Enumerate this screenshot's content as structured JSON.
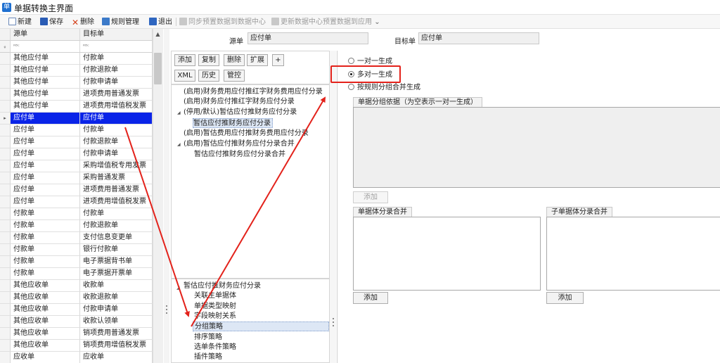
{
  "window": {
    "title": "单据转换主界面"
  },
  "toolbar": {
    "new": "新建",
    "save": "保存",
    "delete": "删除",
    "rule_manage": "规则管理",
    "exit": "退出",
    "sync_preset": "同步预置数据到数据中心",
    "update_center": "更新数据中心预置数据到应用"
  },
  "grid": {
    "col_source": "源单",
    "col_target": "目标单",
    "filter_icon": "filter-abc-icon",
    "rows": [
      {
        "s": "其他应付单",
        "t": "付款单"
      },
      {
        "s": "其他应付单",
        "t": "付款退款单"
      },
      {
        "s": "其他应付单",
        "t": "付款申请单"
      },
      {
        "s": "其他应付单",
        "t": "进项费用普通发票"
      },
      {
        "s": "其他应付单",
        "t": "进项费用增值税发票"
      },
      {
        "s": "应付单",
        "t": "应付单"
      },
      {
        "s": "应付单",
        "t": "付款单"
      },
      {
        "s": "应付单",
        "t": "付款退款单"
      },
      {
        "s": "应付单",
        "t": "付款申请单"
      },
      {
        "s": "应付单",
        "t": "采购增值税专用发票"
      },
      {
        "s": "应付单",
        "t": "采购普通发票"
      },
      {
        "s": "应付单",
        "t": "进项费用普通发票"
      },
      {
        "s": "应付单",
        "t": "进项费用增值税发票"
      },
      {
        "s": "付款单",
        "t": "付款单"
      },
      {
        "s": "付款单",
        "t": "付款退款单"
      },
      {
        "s": "付款单",
        "t": "支付信息变更单"
      },
      {
        "s": "付款单",
        "t": "银行付款单"
      },
      {
        "s": "付款单",
        "t": "电子票据背书单"
      },
      {
        "s": "付款单",
        "t": "电子票据开票单"
      },
      {
        "s": "其他应收单",
        "t": "收款单"
      },
      {
        "s": "其他应收单",
        "t": "收款退款单"
      },
      {
        "s": "其他应收单",
        "t": "付款申请单"
      },
      {
        "s": "其他应收单",
        "t": "收款认领单"
      },
      {
        "s": "其他应收单",
        "t": "销项费用普通发票"
      },
      {
        "s": "其他应收单",
        "t": "销项费用增值税发票"
      },
      {
        "s": "应收单",
        "t": "应收单"
      }
    ],
    "selected_index": 5
  },
  "header": {
    "source_label": "源单",
    "source_value": "应付单",
    "target_label": "目标单",
    "target_value": "应付单"
  },
  "rule_buttons": {
    "add": "添加",
    "copy": "复制",
    "delete": "删除",
    "extend": "扩展",
    "plus": "+",
    "xml": "XML",
    "history": "历史",
    "control": "管控"
  },
  "rules_tree": [
    "(启用)财务费用应付推红字财务费用应付分录",
    "(启用)财务应付推红字财务应付分录",
    "(停用/默认)暂估应付推财务应付分录",
    "暂估应付推财务应付分录",
    "(启用)暂估费用应付推财务费用应付分录",
    "(启用)暂估应付推财务应付分录合并",
    "暂估应付推财务应付分录合并"
  ],
  "config_tree": {
    "root": "暂估应付推财务应付分录",
    "items": [
      "关联主单据体",
      "单据类型映射",
      "字段映射关系",
      "分组策略",
      "排序策略",
      "选单条件策略",
      "插件策略"
    ],
    "selected_index": 3
  },
  "strategy": {
    "options": [
      "一对一生成",
      "多对一生成",
      "按规则分组合并生成"
    ],
    "selected": 1
  },
  "group_basis": {
    "title": "单据分组依据（为空表示一对一生成）",
    "add": "添加"
  },
  "entry_merge": {
    "title": "单据体分录合并",
    "add": "添加"
  },
  "sub_entry_merge": {
    "title": "子单据体分录合并",
    "add": "添加"
  },
  "colors": {
    "selected_row": "#0a24e8",
    "highlight_box": "#e3221b",
    "arrow": "#e3221b"
  }
}
